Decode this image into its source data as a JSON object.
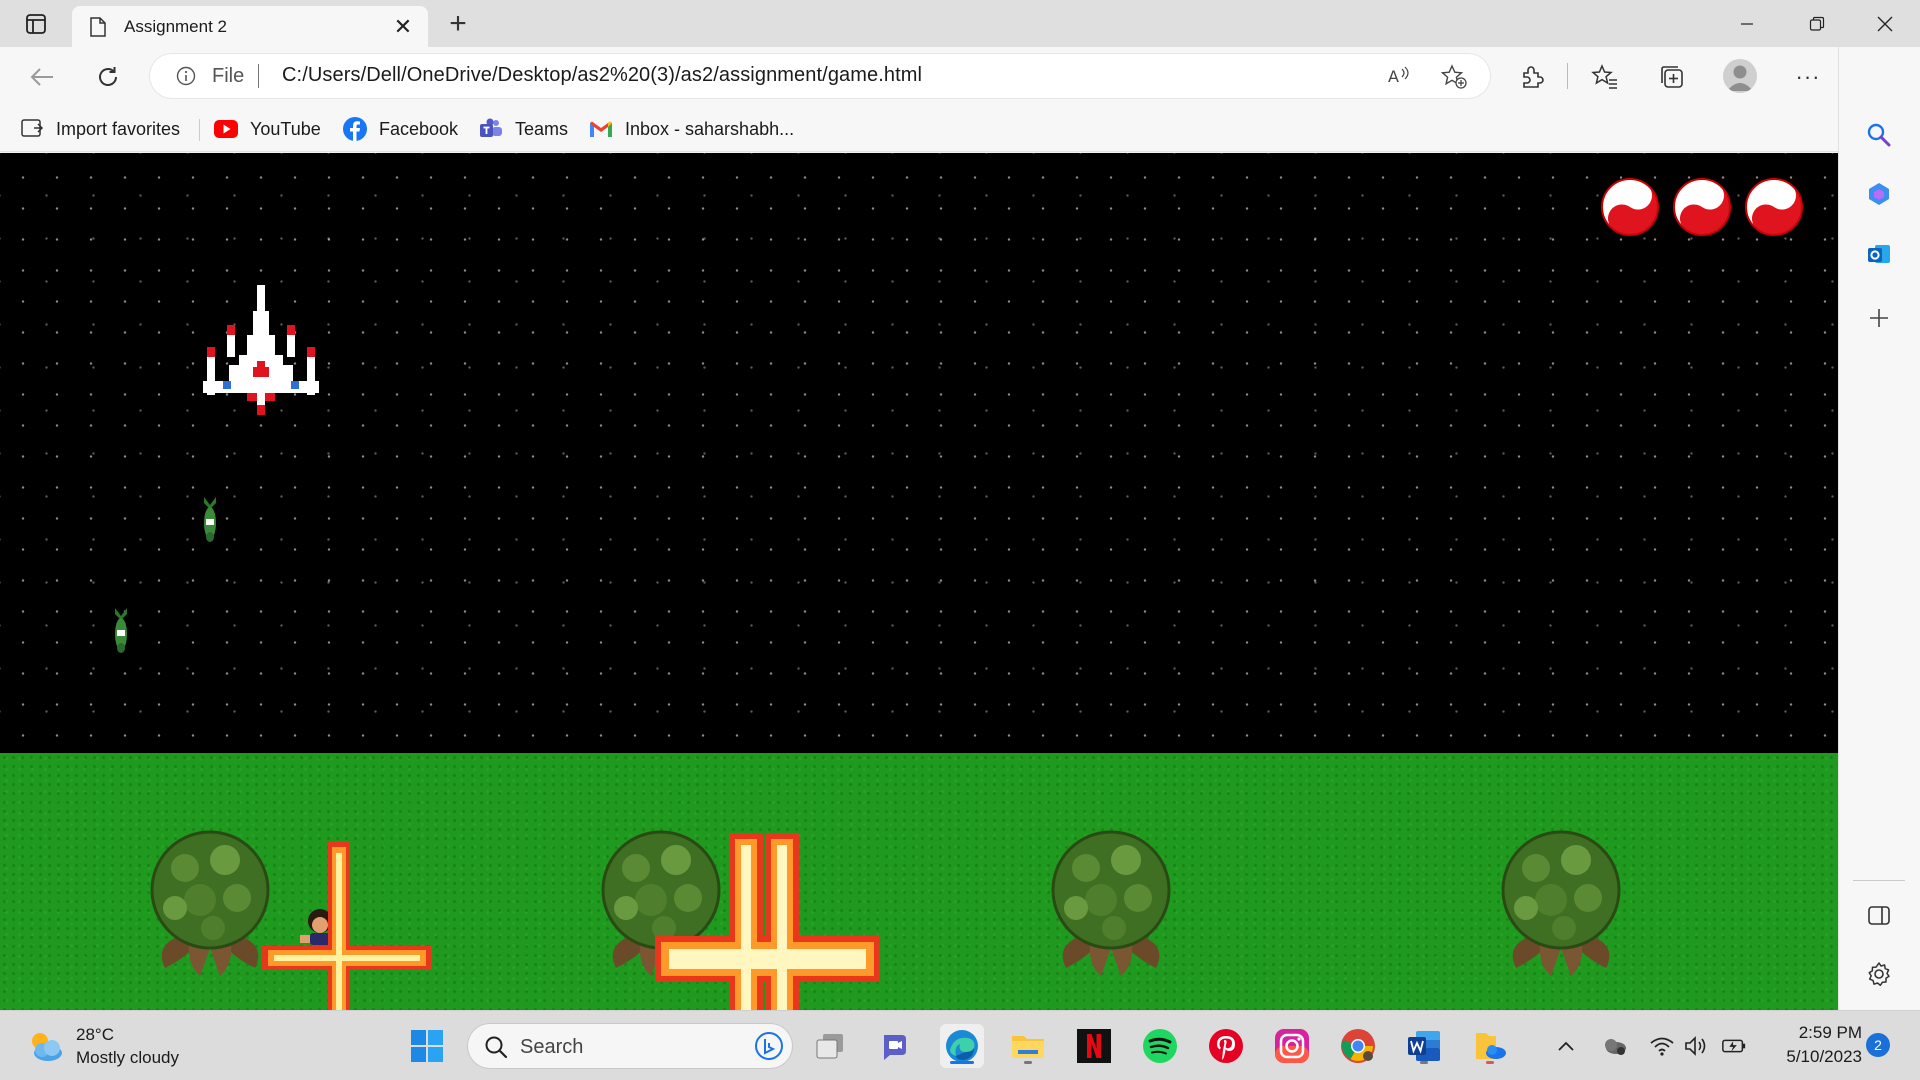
{
  "browser": {
    "tab_title": "Assignment 2",
    "tab_close": "✕",
    "new_tab": "+",
    "address_scheme": "File",
    "url": "C:/Users/Dell/OneDrive/Desktop/as2%20(3)/as2/assignment/game.html",
    "more_menu": "···"
  },
  "favorites": [
    {
      "label": "Import favorites",
      "icon": "import-favorites-icon"
    },
    {
      "label": "YouTube",
      "icon": "youtube-icon"
    },
    {
      "label": "Facebook",
      "icon": "facebook-icon"
    },
    {
      "label": "Teams",
      "icon": "teams-icon"
    },
    {
      "label": "Inbox - saharshabh...",
      "icon": "gmail-icon"
    }
  ],
  "game": {
    "lives_remaining": 3,
    "enemy_bombs_visible": 2,
    "trees": 4,
    "explosions_visible": 2,
    "colors": {
      "space": "#000000",
      "grass": "#1f9a1f"
    }
  },
  "taskbar": {
    "temperature": "28°C",
    "weather": "Mostly cloudy",
    "search_placeholder": "Search",
    "time": "2:59 PM",
    "date": "5/10/2023",
    "notification_count": "2",
    "apps": [
      "start-icon",
      "task-view-icon",
      "meet-icon",
      "edge-icon",
      "file-explorer-icon",
      "netflix-icon",
      "spotify-icon",
      "pinterest-icon",
      "instagram-icon",
      "chrome-icon",
      "word-icon",
      "onedrive-folder-icon"
    ]
  }
}
